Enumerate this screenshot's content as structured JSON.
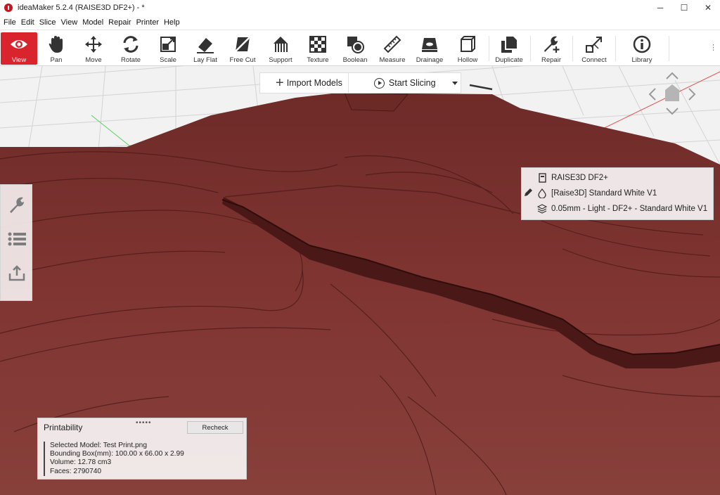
{
  "window": {
    "title": "ideaMaker 5.2.4 (RAISE3D DF2+) - *",
    "controls": {
      "minimize": "─",
      "maximize": "☐",
      "close": "✕"
    }
  },
  "menu": [
    "File",
    "Edit",
    "Slice",
    "View",
    "Model",
    "Repair",
    "Printer",
    "Help"
  ],
  "toolbar": {
    "accent": "#d9232d",
    "tools": [
      {
        "label": "View",
        "icon": "eye-icon",
        "active": true
      },
      {
        "label": "Pan",
        "icon": "hand-icon"
      },
      {
        "label": "Move",
        "icon": "move-arrows-icon"
      },
      {
        "label": "Rotate",
        "icon": "rotate-icon"
      },
      {
        "label": "Scale",
        "icon": "scale-icon"
      },
      {
        "label": "Lay Flat",
        "icon": "lay-flat-icon"
      },
      {
        "label": "Free Cut",
        "icon": "free-cut-icon"
      },
      {
        "label": "Support",
        "icon": "support-icon"
      },
      {
        "label": "Texture",
        "icon": "texture-icon"
      },
      {
        "label": "Boolean",
        "icon": "boolean-icon"
      },
      {
        "label": "Measure",
        "icon": "ruler-icon"
      },
      {
        "label": "Drainage",
        "icon": "drainage-icon"
      },
      {
        "label": "Hollow",
        "icon": "hollow-icon"
      },
      {
        "label": "Duplicate",
        "icon": "duplicate-icon"
      },
      {
        "label": "Repair",
        "icon": "wrench-plus-icon"
      },
      {
        "label": "Connect",
        "icon": "connect-icon"
      },
      {
        "label": "Library",
        "icon": "info-icon"
      }
    ],
    "more": "⋮"
  },
  "slice_bar": {
    "import_label": "Import Models",
    "slice_label": "Start Slicing"
  },
  "printer_panel": {
    "printer": "RAISE3D DF2+",
    "material": "[Raise3D] Standard White V1",
    "profile": "0.05mm - Light - DF2+ - Standard White V1"
  },
  "printability": {
    "title": "Printability",
    "recheck_label": "Recheck",
    "grip": "•••••",
    "lines": [
      "Selected Model: Test Print.png",
      "Bounding Box(mm): 100.00 x 66.00 x 2.99",
      "Volume: 12.78 cm3",
      "Faces: 2790740"
    ]
  },
  "model_color": "#7f3631"
}
